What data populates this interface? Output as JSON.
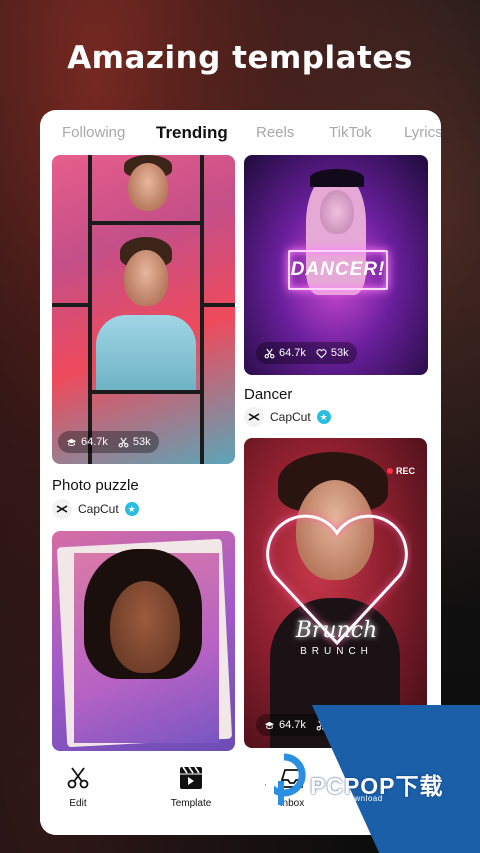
{
  "headline": "Amazing templates",
  "tabs": [
    {
      "label": "Following"
    },
    {
      "label": "Trending"
    },
    {
      "label": "Reels"
    },
    {
      "label": "TikTok"
    },
    {
      "label": "Lyrics"
    }
  ],
  "cards": [
    {
      "title": "Photo puzzle",
      "author": "CapCut",
      "stats": [
        "64.7k",
        "53k"
      ]
    },
    {
      "title": "Dancer",
      "author": "CapCut",
      "stats": [
        "64.7k",
        "53k"
      ],
      "overlay_text": "DANCER!"
    },
    {
      "title": "",
      "author": "",
      "stats": [
        "64.7k",
        ""
      ],
      "overlay_text": "Brunch",
      "overlay_sub": "BRUNCH",
      "badge": "REC"
    },
    {
      "title": "",
      "author": "",
      "stats": []
    }
  ],
  "nav": [
    {
      "label": "Edit",
      "icon": "scissors-icon"
    },
    {
      "label": "Template",
      "icon": "clapper-icon"
    },
    {
      "label": "Inbox",
      "icon": "inbox-icon"
    }
  ],
  "watermark": {
    "text": "PCPOP下载",
    "sub": "PCPOP Download"
  },
  "colors": {
    "verify": "#2bbce0",
    "watermark": "#1a5fa8",
    "active_tab": "#111111",
    "inactive_tab": "#a8a8a8"
  }
}
